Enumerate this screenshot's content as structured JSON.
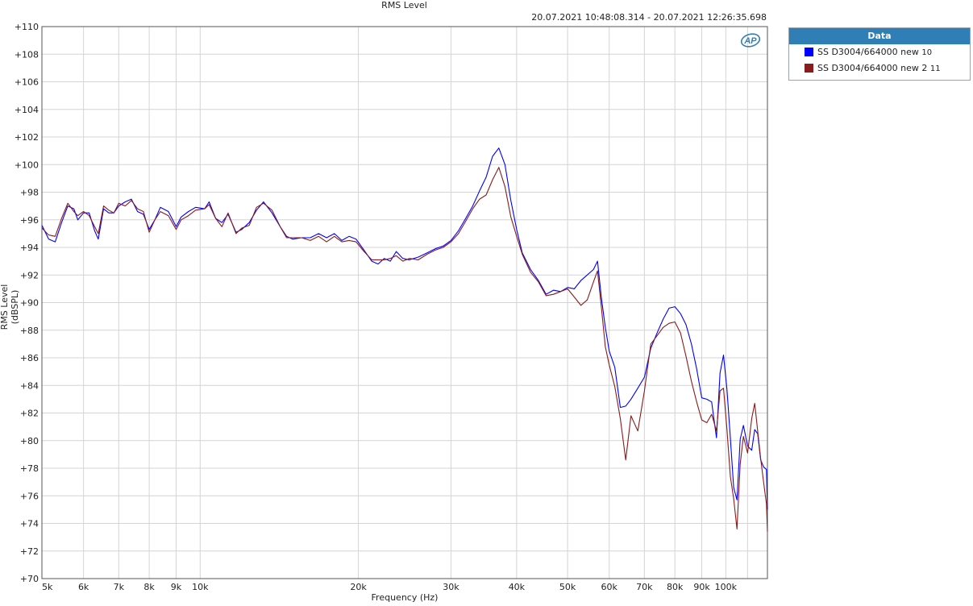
{
  "header": {
    "title": "RMS Level",
    "timestamp": "20.07.2021 10:48:08.314 - 20.07.2021 12:26:35.698"
  },
  "legend": {
    "title": "Data",
    "items": [
      {
        "label": "SS D3004/664000 new",
        "num": "10",
        "color": "#0000ff"
      },
      {
        "label": "SS D3004/664000 new 2",
        "num": "11",
        "color": "#8b1a1a"
      }
    ]
  },
  "logo": {
    "text": "AP"
  },
  "chart_data": {
    "type": "line",
    "title": "RMS Level",
    "xlabel": "Frequency (Hz)",
    "ylabel": "RMS Level (dBSPL)",
    "x_scale": "log",
    "xlim": [
      5000,
      120000
    ],
    "ylim": [
      70,
      110
    ],
    "grid": true,
    "legend_position": "right",
    "x_ticks": [
      {
        "v": 5000,
        "l": "5k"
      },
      {
        "v": 6000,
        "l": "6k"
      },
      {
        "v": 7000,
        "l": "7k"
      },
      {
        "v": 8000,
        "l": "8k"
      },
      {
        "v": 9000,
        "l": "9k"
      },
      {
        "v": 10000,
        "l": "10k"
      },
      {
        "v": 20000,
        "l": "20k"
      },
      {
        "v": 30000,
        "l": "30k"
      },
      {
        "v": 40000,
        "l": "40k"
      },
      {
        "v": 50000,
        "l": "50k"
      },
      {
        "v": 60000,
        "l": "60k"
      },
      {
        "v": 70000,
        "l": "70k"
      },
      {
        "v": 80000,
        "l": "80k"
      },
      {
        "v": 90000,
        "l": "90k"
      },
      {
        "v": 100000,
        "l": "100k"
      }
    ],
    "y_ticks": [
      {
        "v": 110,
        "l": "+110"
      },
      {
        "v": 108,
        "l": "+108"
      },
      {
        "v": 106,
        "l": "+106"
      },
      {
        "v": 104,
        "l": "+104"
      },
      {
        "v": 102,
        "l": "+102"
      },
      {
        "v": 100,
        "l": "+100"
      },
      {
        "v": 98,
        "l": "+98"
      },
      {
        "v": 96,
        "l": "+96"
      },
      {
        "v": 94,
        "l": "+94"
      },
      {
        "v": 92,
        "l": "+92"
      },
      {
        "v": 90,
        "l": "+90"
      },
      {
        "v": 88,
        "l": "+88"
      },
      {
        "v": 86,
        "l": "+86"
      },
      {
        "v": 84,
        "l": "+84"
      },
      {
        "v": 82,
        "l": "+82"
      },
      {
        "v": 80,
        "l": "+80"
      },
      {
        "v": 78,
        "l": "+78"
      },
      {
        "v": 76,
        "l": "+76"
      },
      {
        "v": 74,
        "l": "+74"
      },
      {
        "v": 72,
        "l": "+72"
      },
      {
        "v": 70,
        "l": "+70"
      }
    ],
    "series": [
      {
        "name": "SS D3004/664000 new 10",
        "color": "#0000ff",
        "points": [
          [
            5000,
            95.6
          ],
          [
            5150,
            94.6
          ],
          [
            5300,
            94.4
          ],
          [
            5450,
            95.8
          ],
          [
            5600,
            97.0
          ],
          [
            5750,
            96.8
          ],
          [
            5850,
            96.0
          ],
          [
            6000,
            96.5
          ],
          [
            6150,
            96.5
          ],
          [
            6300,
            95.2
          ],
          [
            6400,
            94.6
          ],
          [
            6550,
            96.8
          ],
          [
            6700,
            96.5
          ],
          [
            6850,
            96.5
          ],
          [
            7000,
            97.0
          ],
          [
            7200,
            97.3
          ],
          [
            7400,
            97.5
          ],
          [
            7600,
            96.6
          ],
          [
            7800,
            96.4
          ],
          [
            8000,
            95.3
          ],
          [
            8200,
            96.0
          ],
          [
            8400,
            96.9
          ],
          [
            8700,
            96.6
          ],
          [
            9000,
            95.5
          ],
          [
            9200,
            96.2
          ],
          [
            9500,
            96.6
          ],
          [
            9800,
            96.9
          ],
          [
            10200,
            96.8
          ],
          [
            10400,
            97.3
          ],
          [
            10700,
            96.1
          ],
          [
            11000,
            95.8
          ],
          [
            11300,
            96.4
          ],
          [
            11700,
            95.1
          ],
          [
            12000,
            95.3
          ],
          [
            12400,
            95.8
          ],
          [
            12800,
            96.7
          ],
          [
            13200,
            97.3
          ],
          [
            13700,
            96.5
          ],
          [
            14200,
            95.5
          ],
          [
            14600,
            94.8
          ],
          [
            15000,
            94.6
          ],
          [
            15600,
            94.7
          ],
          [
            16200,
            94.7
          ],
          [
            16800,
            95.0
          ],
          [
            17400,
            94.7
          ],
          [
            18000,
            95.0
          ],
          [
            18600,
            94.5
          ],
          [
            19200,
            94.8
          ],
          [
            19800,
            94.6
          ],
          [
            20500,
            93.8
          ],
          [
            21200,
            93.0
          ],
          [
            21800,
            92.8
          ],
          [
            22400,
            93.2
          ],
          [
            23000,
            93.0
          ],
          [
            23600,
            93.7
          ],
          [
            24300,
            93.2
          ],
          [
            25000,
            93.1
          ],
          [
            26000,
            93.3
          ],
          [
            27000,
            93.6
          ],
          [
            28000,
            93.9
          ],
          [
            29000,
            94.1
          ],
          [
            30000,
            94.5
          ],
          [
            31000,
            95.2
          ],
          [
            32000,
            96.1
          ],
          [
            33000,
            97.0
          ],
          [
            34000,
            98.1
          ],
          [
            35000,
            99.1
          ],
          [
            36000,
            100.6
          ],
          [
            37000,
            101.2
          ],
          [
            38000,
            100.0
          ],
          [
            39000,
            97.4
          ],
          [
            40000,
            95.3
          ],
          [
            41000,
            93.6
          ],
          [
            42500,
            92.4
          ],
          [
            44000,
            91.6
          ],
          [
            45500,
            90.6
          ],
          [
            47000,
            90.9
          ],
          [
            48500,
            90.8
          ],
          [
            50000,
            91.1
          ],
          [
            51500,
            91.0
          ],
          [
            53000,
            91.6
          ],
          [
            54500,
            92.0
          ],
          [
            56000,
            92.4
          ],
          [
            57000,
            93.0
          ],
          [
            58000,
            90.3
          ],
          [
            59000,
            88.2
          ],
          [
            60000,
            86.5
          ],
          [
            61500,
            85.3
          ],
          [
            63000,
            82.4
          ],
          [
            64500,
            82.5
          ],
          [
            66000,
            83.0
          ],
          [
            68000,
            83.8
          ],
          [
            70000,
            84.6
          ],
          [
            72000,
            86.7
          ],
          [
            74000,
            87.8
          ],
          [
            76000,
            88.8
          ],
          [
            78000,
            89.6
          ],
          [
            80000,
            89.7
          ],
          [
            82000,
            89.2
          ],
          [
            84000,
            88.4
          ],
          [
            86000,
            87.0
          ],
          [
            88000,
            85.2
          ],
          [
            90000,
            83.1
          ],
          [
            92000,
            83.0
          ],
          [
            94000,
            82.8
          ],
          [
            96000,
            80.2
          ],
          [
            97500,
            84.9
          ],
          [
            99000,
            86.2
          ],
          [
            100500,
            83.7
          ],
          [
            102000,
            80.2
          ],
          [
            103500,
            76.6
          ],
          [
            105000,
            75.7
          ],
          [
            106500,
            80.1
          ],
          [
            108000,
            81.1
          ],
          [
            110000,
            79.6
          ],
          [
            112000,
            79.3
          ],
          [
            113500,
            80.8
          ],
          [
            115000,
            80.5
          ],
          [
            116500,
            78.6
          ],
          [
            118000,
            78.1
          ],
          [
            119500,
            77.9
          ],
          [
            120000,
            75.0
          ]
        ]
      },
      {
        "name": "SS D3004/664000 new 2 11",
        "color": "#8b1a1a",
        "points": [
          [
            5000,
            95.4
          ],
          [
            5150,
            94.9
          ],
          [
            5300,
            94.8
          ],
          [
            5450,
            96.1
          ],
          [
            5600,
            97.2
          ],
          [
            5750,
            96.6
          ],
          [
            5850,
            96.3
          ],
          [
            6000,
            96.6
          ],
          [
            6150,
            96.3
          ],
          [
            6300,
            95.5
          ],
          [
            6400,
            95.0
          ],
          [
            6550,
            97.0
          ],
          [
            6700,
            96.7
          ],
          [
            6850,
            96.5
          ],
          [
            7000,
            97.2
          ],
          [
            7200,
            97.0
          ],
          [
            7400,
            97.4
          ],
          [
            7600,
            96.8
          ],
          [
            7800,
            96.6
          ],
          [
            8000,
            95.1
          ],
          [
            8200,
            96.0
          ],
          [
            8400,
            96.6
          ],
          [
            8700,
            96.3
          ],
          [
            9000,
            95.3
          ],
          [
            9200,
            96.0
          ],
          [
            9500,
            96.3
          ],
          [
            9800,
            96.7
          ],
          [
            10200,
            96.8
          ],
          [
            10400,
            97.1
          ],
          [
            10700,
            96.1
          ],
          [
            11000,
            95.5
          ],
          [
            11300,
            96.5
          ],
          [
            11700,
            95.0
          ],
          [
            12000,
            95.4
          ],
          [
            12400,
            95.6
          ],
          [
            12800,
            96.9
          ],
          [
            13200,
            97.2
          ],
          [
            13700,
            96.7
          ],
          [
            14200,
            95.5
          ],
          [
            14600,
            94.7
          ],
          [
            15000,
            94.7
          ],
          [
            15600,
            94.7
          ],
          [
            16200,
            94.5
          ],
          [
            16800,
            94.8
          ],
          [
            17400,
            94.4
          ],
          [
            18000,
            94.8
          ],
          [
            18600,
            94.4
          ],
          [
            19200,
            94.5
          ],
          [
            19800,
            94.4
          ],
          [
            20500,
            93.7
          ],
          [
            21200,
            93.1
          ],
          [
            21800,
            93.1
          ],
          [
            22400,
            93.1
          ],
          [
            23000,
            93.2
          ],
          [
            23600,
            93.4
          ],
          [
            24300,
            93.0
          ],
          [
            25000,
            93.2
          ],
          [
            26000,
            93.1
          ],
          [
            27000,
            93.5
          ],
          [
            28000,
            93.8
          ],
          [
            29000,
            94.0
          ],
          [
            30000,
            94.4
          ],
          [
            31000,
            95.0
          ],
          [
            32000,
            95.9
          ],
          [
            33000,
            96.8
          ],
          [
            34000,
            97.5
          ],
          [
            35000,
            97.8
          ],
          [
            36000,
            98.9
          ],
          [
            37000,
            99.8
          ],
          [
            38000,
            98.4
          ],
          [
            39000,
            96.2
          ],
          [
            40000,
            94.8
          ],
          [
            41000,
            93.5
          ],
          [
            42500,
            92.2
          ],
          [
            44000,
            91.5
          ],
          [
            45500,
            90.5
          ],
          [
            47000,
            90.6
          ],
          [
            48500,
            90.8
          ],
          [
            50000,
            91.0
          ],
          [
            51500,
            90.4
          ],
          [
            53000,
            89.8
          ],
          [
            54500,
            90.2
          ],
          [
            56000,
            91.5
          ],
          [
            57000,
            92.3
          ],
          [
            58000,
            89.6
          ],
          [
            59000,
            86.8
          ],
          [
            60000,
            85.5
          ],
          [
            61500,
            83.9
          ],
          [
            63000,
            81.6
          ],
          [
            64500,
            78.6
          ],
          [
            66000,
            81.8
          ],
          [
            68000,
            80.7
          ],
          [
            70000,
            83.6
          ],
          [
            72000,
            87.0
          ],
          [
            74000,
            87.6
          ],
          [
            76000,
            88.2
          ],
          [
            78000,
            88.5
          ],
          [
            80000,
            88.6
          ],
          [
            82000,
            87.8
          ],
          [
            84000,
            86.1
          ],
          [
            86000,
            84.3
          ],
          [
            88000,
            82.8
          ],
          [
            90000,
            81.5
          ],
          [
            92000,
            81.3
          ],
          [
            94000,
            81.9
          ],
          [
            96000,
            80.7
          ],
          [
            97500,
            83.6
          ],
          [
            99000,
            83.8
          ],
          [
            100500,
            80.8
          ],
          [
            102000,
            77.4
          ],
          [
            103500,
            75.8
          ],
          [
            105000,
            73.6
          ],
          [
            106500,
            78.3
          ],
          [
            108000,
            80.3
          ],
          [
            110000,
            79.1
          ],
          [
            112000,
            81.6
          ],
          [
            113500,
            82.7
          ],
          [
            115000,
            80.7
          ],
          [
            116500,
            78.7
          ],
          [
            118000,
            77.0
          ],
          [
            119500,
            75.4
          ],
          [
            120000,
            73.4
          ]
        ]
      }
    ]
  }
}
